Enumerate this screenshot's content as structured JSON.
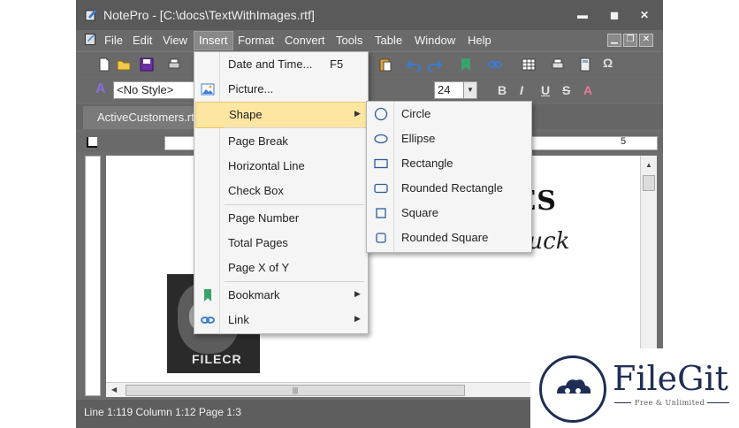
{
  "window": {
    "title": "NotePro - [C:\\docs\\TextWithImages.rtf]",
    "minimize": "▬",
    "maximize": "◼",
    "close": "✕"
  },
  "menubar": {
    "items": [
      "File",
      "Edit",
      "View",
      "Insert",
      "Format",
      "Convert",
      "Tools",
      "Table",
      "Window",
      "Help"
    ],
    "active": "Insert"
  },
  "toolbar2": {
    "style_value": "<No Style>",
    "size_value": "24",
    "bold": "B",
    "italic": "I",
    "underline": "U",
    "strike": "S"
  },
  "tab": {
    "label": "ActiveCustomers.rt"
  },
  "document": {
    "heading_partial": "ALES",
    "script_partial": "Fun in Luck",
    "watermark": "FILECR"
  },
  "status": {
    "text": "Line 1:119  Column 1:12  Page 1:3"
  },
  "insert_menu": {
    "items": [
      {
        "label": "Date and Time...",
        "key": "F5"
      },
      {
        "label": "Picture..."
      },
      {
        "label": "Shape",
        "arrow": "▶"
      },
      {
        "label": "Page Break"
      },
      {
        "label": "Horizontal Line"
      },
      {
        "label": "Check Box"
      },
      {
        "label": "Page Number"
      },
      {
        "label": "Total Pages"
      },
      {
        "label": "Page X of Y"
      },
      {
        "label": "Bookmark",
        "arrow": "▶"
      },
      {
        "label": "Link",
        "arrow": "▶"
      }
    ]
  },
  "shape_menu": {
    "items": [
      "Circle",
      "Ellipse",
      "Rectangle",
      "Rounded Rectangle",
      "Square",
      "Rounded Square"
    ]
  },
  "watermark": {
    "name": "FileGit",
    "tagline": "Free & Unlimited"
  },
  "colors": {
    "highlight": "#fde6a2",
    "brand": "#1e2e55",
    "accent": "#2a6ebb"
  }
}
